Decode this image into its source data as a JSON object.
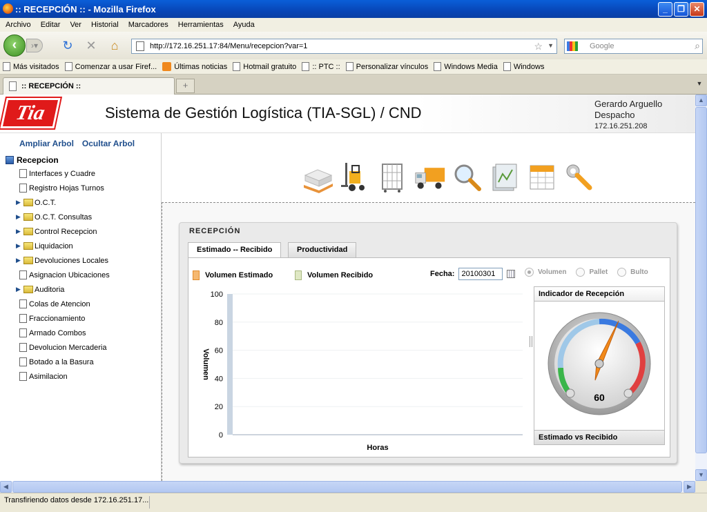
{
  "window": {
    "title": ":: RECEPCIÓN :: - Mozilla Firefox"
  },
  "menu": [
    "Archivo",
    "Editar",
    "Ver",
    "Historial",
    "Marcadores",
    "Herramientas",
    "Ayuda"
  ],
  "url": "http://172.16.251.17:84/Menu/recepcion?var=1",
  "search": {
    "placeholder": "Google"
  },
  "bookmarks": [
    "Más visitados",
    "Comenzar a usar Firef...",
    "Últimas noticias",
    "Hotmail gratuito",
    ":: PTC ::",
    "Personalizar vínculos",
    "Windows Media",
    "Windows"
  ],
  "tab": {
    "label": ":: RECEPCIÓN ::"
  },
  "app": {
    "logo": "Tia",
    "title": "Sistema de Gestión Logística (TIA-SGL) / CND"
  },
  "user": {
    "name": "Gerardo Arguello",
    "dept": "Despacho",
    "ip": "172.16.251.208"
  },
  "tree": {
    "expand_label": "Ampliar Arbol",
    "hide_label": "Ocultar Arbol",
    "root": "Recepcion",
    "items": [
      {
        "label": "Interfaces y Cuadre",
        "type": "doc"
      },
      {
        "label": "Registro Hojas Turnos",
        "type": "doc"
      },
      {
        "label": "O.C.T.",
        "type": "folder"
      },
      {
        "label": "O.C.T. Consultas",
        "type": "folder"
      },
      {
        "label": "Control Recepcion",
        "type": "folder"
      },
      {
        "label": "Liquidacion",
        "type": "folder"
      },
      {
        "label": "Devoluciones Locales",
        "type": "folder"
      },
      {
        "label": "Asignacion Ubicaciones",
        "type": "doc"
      },
      {
        "label": "Auditoria",
        "type": "folder"
      },
      {
        "label": "Colas de Atencion",
        "type": "doc"
      },
      {
        "label": "Fraccionamiento",
        "type": "doc"
      },
      {
        "label": "Armado Combos",
        "type": "doc"
      },
      {
        "label": "Devolucion Mercaderia",
        "type": "doc"
      },
      {
        "label": "Botado a la Basura",
        "type": "doc"
      },
      {
        "label": "Asimilacion",
        "type": "doc"
      }
    ]
  },
  "toolbar_icons": [
    "pallet-icon",
    "forklift-icon",
    "cart-icon",
    "truck-icon",
    "magnifier-icon",
    "folder-chart-icon",
    "calendar-icon",
    "wrench-icon"
  ],
  "panel": {
    "title": "RECEPCIÓN",
    "tabs": [
      "Estimado -- Recibido",
      "Productividad"
    ],
    "legend": {
      "estimado": "Volumen Estimado",
      "recibido": "Volumen Recibido",
      "estimado_color": "#f5b870",
      "recibido_color": "#dfe8c4"
    },
    "fecha_label": "Fecha:",
    "fecha_value": "20100301",
    "radios": [
      "Volumen",
      "Pallet",
      "Bulto"
    ],
    "gauge_title": "Indicador de Recepción",
    "gauge_value": "60",
    "gauge_footer": "Estimado vs Recibido"
  },
  "chart_data": {
    "type": "bar",
    "xlabel": "Horas",
    "ylabel": "Volumen",
    "ylim": [
      0,
      100
    ],
    "yticks": [
      "100",
      "80",
      "60",
      "40",
      "20",
      "0"
    ],
    "categories": [],
    "series": [
      {
        "name": "Volumen Estimado",
        "values": []
      },
      {
        "name": "Volumen Recibido",
        "values": []
      }
    ]
  },
  "status": "Transfiriendo datos desde 172.16.251.17..."
}
